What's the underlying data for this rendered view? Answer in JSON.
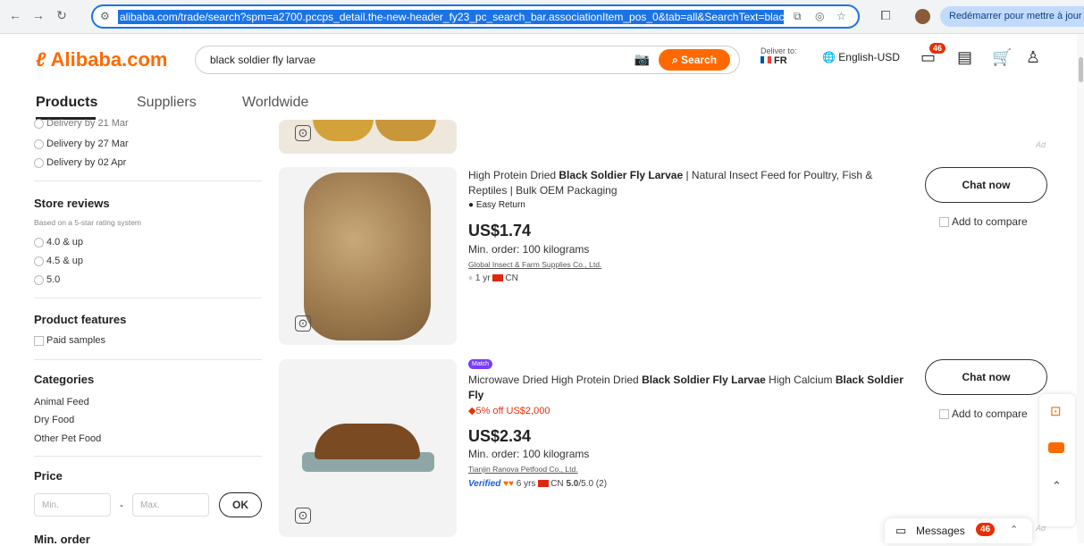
{
  "browser": {
    "url": "alibaba.com/trade/search?spm=a2700.pccps_detail.the-new-header_fy23_pc_search_bar.associationItem_pos_0&tab=all&SearchText=black+soldier+fly+l",
    "restart_label": "Redémarrer pour mettre à jour"
  },
  "header": {
    "logo": "Alibaba.com",
    "search_value": "black soldier fly larvae",
    "search_button": "Search",
    "deliver_label": "Deliver to:",
    "deliver_country": "FR",
    "language": "English-USD",
    "messages_badge": "46",
    "tabs": [
      {
        "label": "Products"
      },
      {
        "label": "Suppliers"
      },
      {
        "label": "Worldwide"
      }
    ]
  },
  "sidebar": {
    "delivery_options": [
      "Delivery by 21 Mar",
      "Delivery by 27 Mar",
      "Delivery by 02 Apr"
    ],
    "store_reviews_title": "Store reviews",
    "store_reviews_sub": "Based on a 5-star rating system",
    "rating_options": [
      "4.0 & up",
      "4.5 & up",
      "5.0"
    ],
    "features_title": "Product features",
    "features_options": [
      "Paid samples"
    ],
    "categories_title": "Categories",
    "categories": [
      "Animal Feed",
      "Dry Food",
      "Other Pet Food"
    ],
    "price_title": "Price",
    "price_min_placeholder": "Min.",
    "price_dash": "-",
    "price_max_placeholder": "Max.",
    "price_ok": "OK",
    "min_order_title": "Min. order"
  },
  "products": [
    {
      "title_parts": [
        "High Protein Dried ",
        "Black Soldier Fly Larvae",
        " | Natural Insect Feed for Poultry, Fish & Reptiles | Bulk OEM Packaging"
      ],
      "tag": "Easy Return",
      "price": "US$1.74",
      "min_order": "Min. order: 100 kilograms",
      "supplier": "Global Insect & Farm Supplies Co., Ltd.",
      "years": "1 yr",
      "country": "CN",
      "chat": "Chat now",
      "compare": "Add to compare"
    },
    {
      "badge": "Match",
      "title_parts": [
        "Microwave Dried High Protein Dried ",
        "Black Soldier Fly Larvae",
        " High Calcium ",
        "Black Soldier Fly"
      ],
      "discount": "5% off US$2,000",
      "price": "US$2.34",
      "min_order": "Min. order: 100 kilograms",
      "supplier": "Tianjin Ranova Petfood Co., Ltd.",
      "verified": "Verified",
      "years": "6 yrs",
      "country": "CN",
      "rating": "5.0",
      "rating_suffix": "/5.0 (2)",
      "chat": "Chat now",
      "compare": "Add to compare"
    }
  ],
  "ad_label": "Ad",
  "messages_label": "Messages",
  "messages_count": "46",
  "colors": {
    "brand": "#ff6a00",
    "badge": "#e62e04",
    "link": "#1a73e8"
  }
}
